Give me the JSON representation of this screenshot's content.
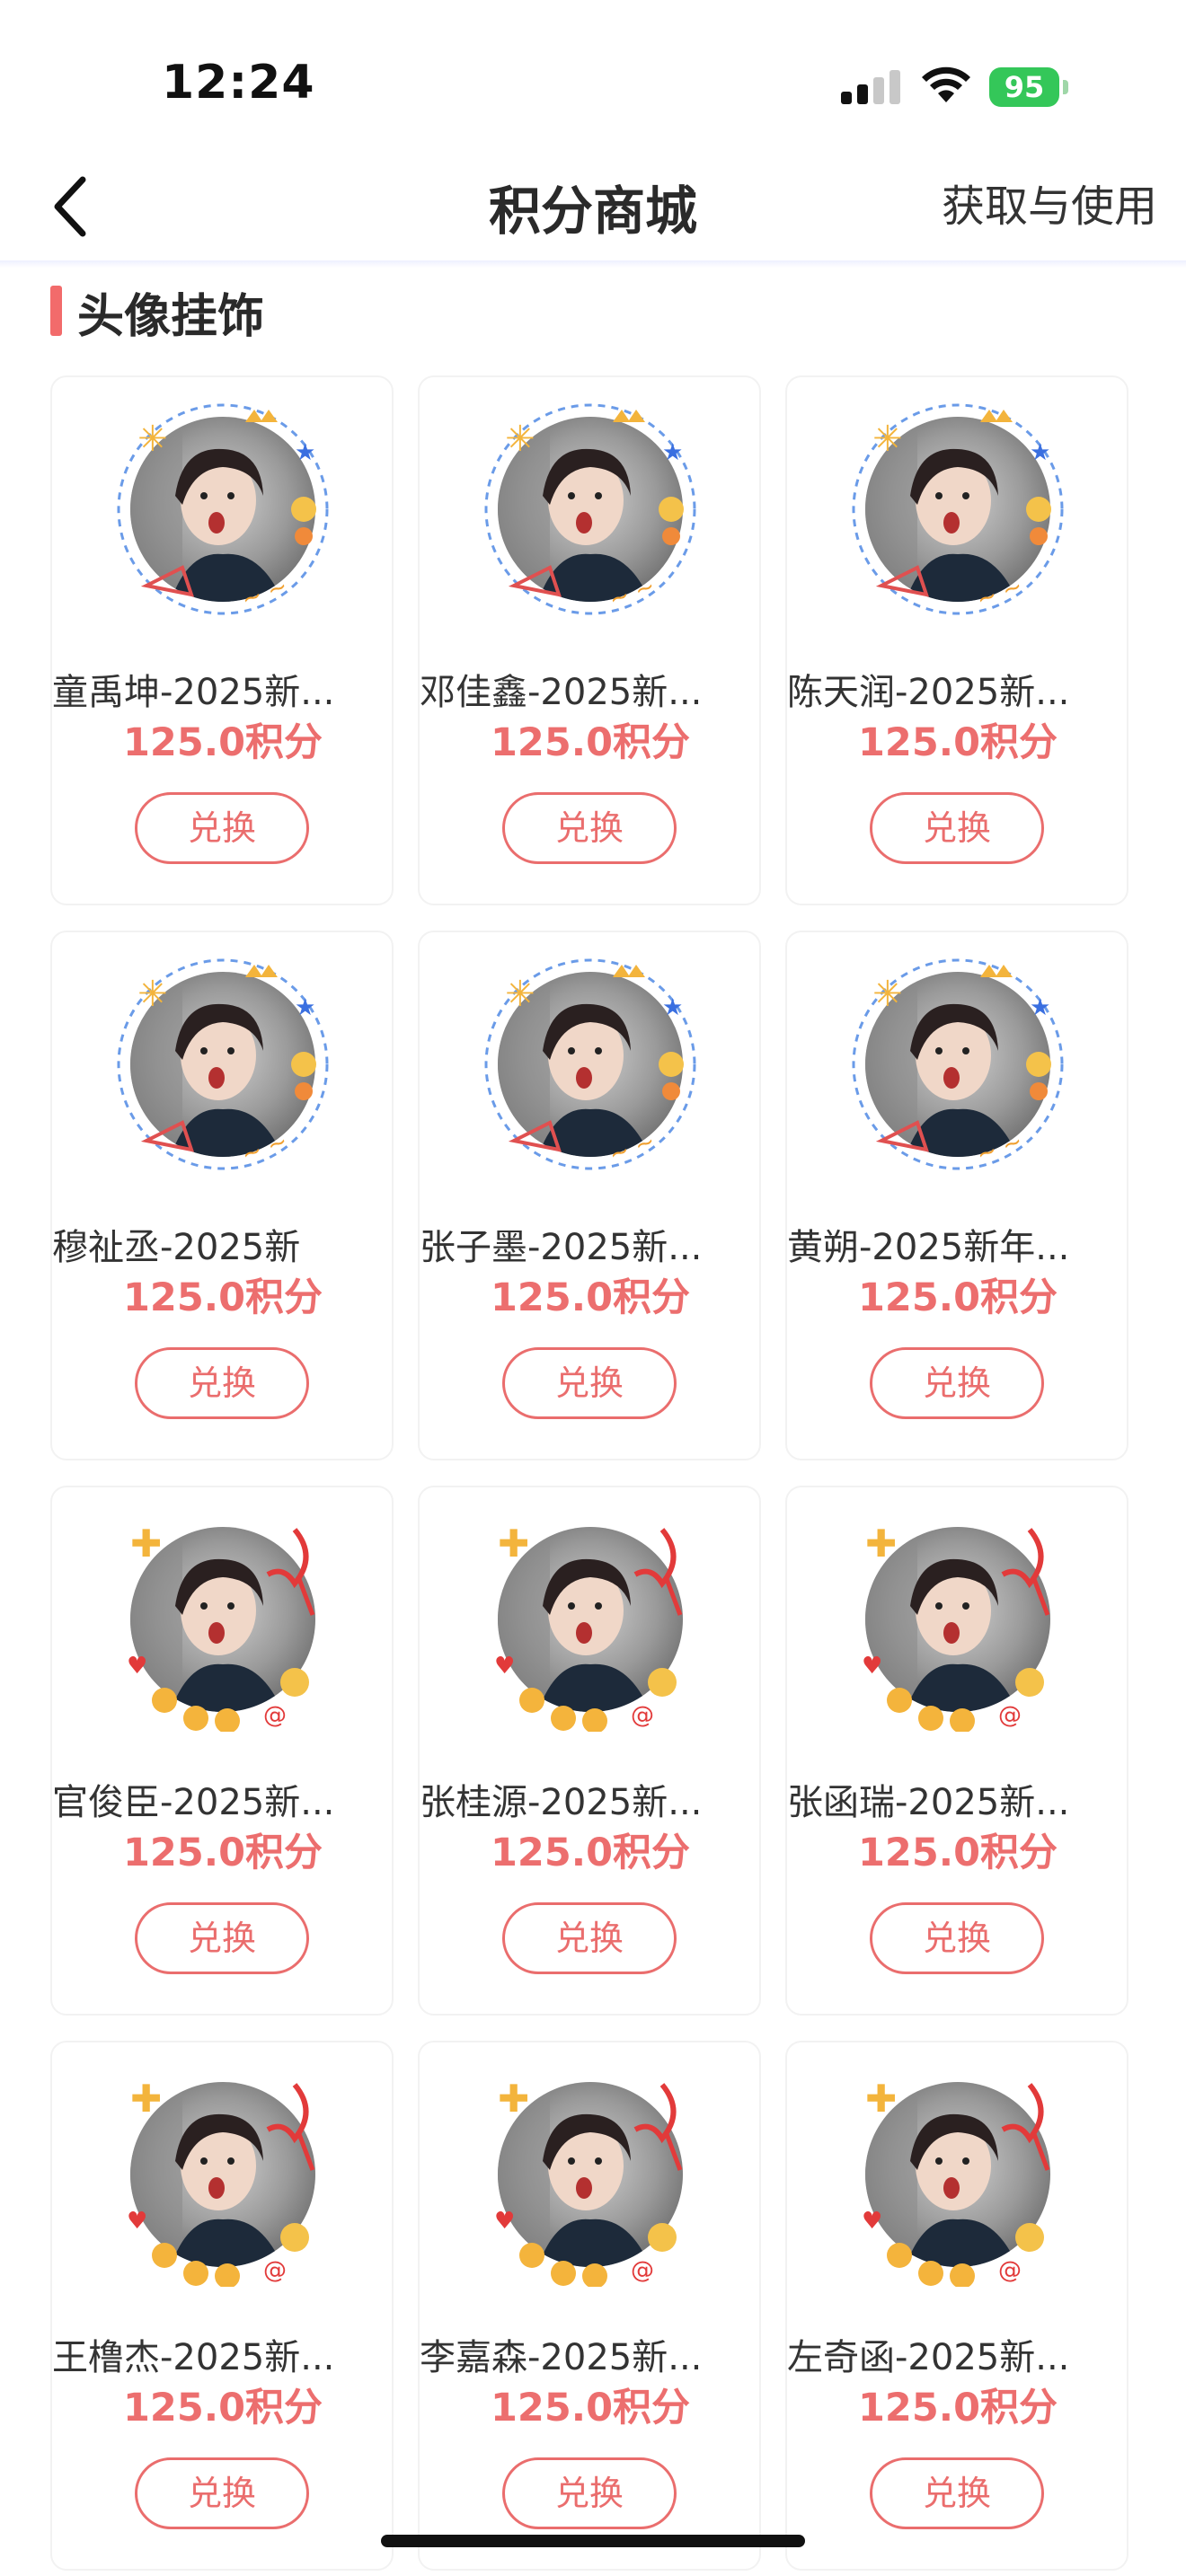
{
  "status": {
    "time": "12:24",
    "battery": "95"
  },
  "nav": {
    "title": "积分商城",
    "right_link": "获取与使用"
  },
  "section": {
    "title": "头像挂饰"
  },
  "items": [
    {
      "name": "童禹坤-2025新...",
      "price": "125.0积分",
      "button": "兑换"
    },
    {
      "name": "邓佳鑫-2025新...",
      "price": "125.0积分",
      "button": "兑换"
    },
    {
      "name": "陈天润-2025新...",
      "price": "125.0积分",
      "button": "兑换"
    },
    {
      "name": "穆祉丞-2025新",
      "price": "125.0积分",
      "button": "兑换"
    },
    {
      "name": "张子墨-2025新...",
      "price": "125.0积分",
      "button": "兑换"
    },
    {
      "name": "黄朔-2025新年...",
      "price": "125.0积分",
      "button": "兑换"
    },
    {
      "name": "官俊臣-2025新...",
      "price": "125.0积分",
      "button": "兑换"
    },
    {
      "name": "张桂源-2025新...",
      "price": "125.0积分",
      "button": "兑换"
    },
    {
      "name": "张函瑞-2025新...",
      "price": "125.0积分",
      "button": "兑换"
    },
    {
      "name": "王橹杰-2025新...",
      "price": "125.0积分",
      "button": "兑换"
    },
    {
      "name": "李嘉森-2025新...",
      "price": "125.0积分",
      "button": "兑换"
    },
    {
      "name": "左奇函-2025新...",
      "price": "125.0积分",
      "button": "兑换"
    }
  ],
  "colors": {
    "accent": "#ec6e6e",
    "battery": "#34c759"
  }
}
